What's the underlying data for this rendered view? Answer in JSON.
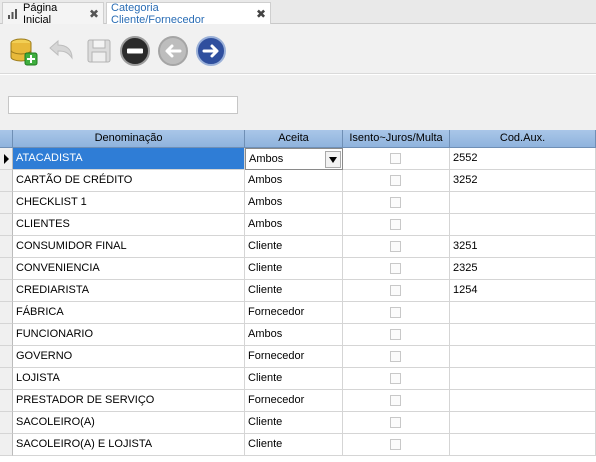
{
  "tabs": [
    {
      "label": "Página Inicial",
      "active": false
    },
    {
      "label": "Categoria Cliente/Fornecedor",
      "active": true
    }
  ],
  "tab_close_glyph": "✖",
  "toolbar": {
    "buttons": [
      {
        "icon": "database-add-icon",
        "enabled": true
      },
      {
        "icon": "undo-icon",
        "enabled": false
      },
      {
        "icon": "save-icon",
        "enabled": false
      },
      {
        "icon": "delete-icon",
        "enabled": true
      },
      {
        "icon": "previous-icon",
        "enabled": false
      },
      {
        "icon": "next-icon",
        "enabled": true
      }
    ]
  },
  "filter": {
    "value": "",
    "placeholder": ""
  },
  "grid": {
    "columns": [
      "Denominação",
      "Aceita",
      "Isento~Juros/Multa",
      "Cod.Aux."
    ],
    "selected_row": 0,
    "rows": [
      {
        "denominacao": "ATACADISTA",
        "aceita": "Ambos",
        "isento": false,
        "cod_aux": "2552"
      },
      {
        "denominacao": "CARTÃO DE CRÉDITO",
        "aceita": "Ambos",
        "isento": false,
        "cod_aux": "3252"
      },
      {
        "denominacao": "CHECKLIST 1",
        "aceita": "Ambos",
        "isento": false,
        "cod_aux": ""
      },
      {
        "denominacao": "CLIENTES",
        "aceita": "Ambos",
        "isento": false,
        "cod_aux": ""
      },
      {
        "denominacao": "CONSUMIDOR FINAL",
        "aceita": "Cliente",
        "isento": false,
        "cod_aux": "3251"
      },
      {
        "denominacao": "CONVENIENCIA",
        "aceita": "Cliente",
        "isento": false,
        "cod_aux": "2325"
      },
      {
        "denominacao": "CREDIARISTA",
        "aceita": "Cliente",
        "isento": false,
        "cod_aux": "1254"
      },
      {
        "denominacao": "FÁBRICA",
        "aceita": "Fornecedor",
        "isento": false,
        "cod_aux": ""
      },
      {
        "denominacao": "FUNCIONARIO",
        "aceita": "Ambos",
        "isento": false,
        "cod_aux": ""
      },
      {
        "denominacao": "GOVERNO",
        "aceita": "Fornecedor",
        "isento": false,
        "cod_aux": ""
      },
      {
        "denominacao": "LOJISTA",
        "aceita": "Cliente",
        "isento": false,
        "cod_aux": ""
      },
      {
        "denominacao": "PRESTADOR DE SERVIÇO",
        "aceita": "Fornecedor",
        "isento": false,
        "cod_aux": ""
      },
      {
        "denominacao": "SACOLEIRO(A)",
        "aceita": "Cliente",
        "isento": false,
        "cod_aux": ""
      },
      {
        "denominacao": "SACOLEIRO(A) E LOJISTA",
        "aceita": "Cliente",
        "isento": false,
        "cod_aux": ""
      }
    ]
  },
  "colors": {
    "header": "#9dbde3",
    "selection": "#2f7dd6",
    "tab_active_text": "#2a6db5"
  }
}
